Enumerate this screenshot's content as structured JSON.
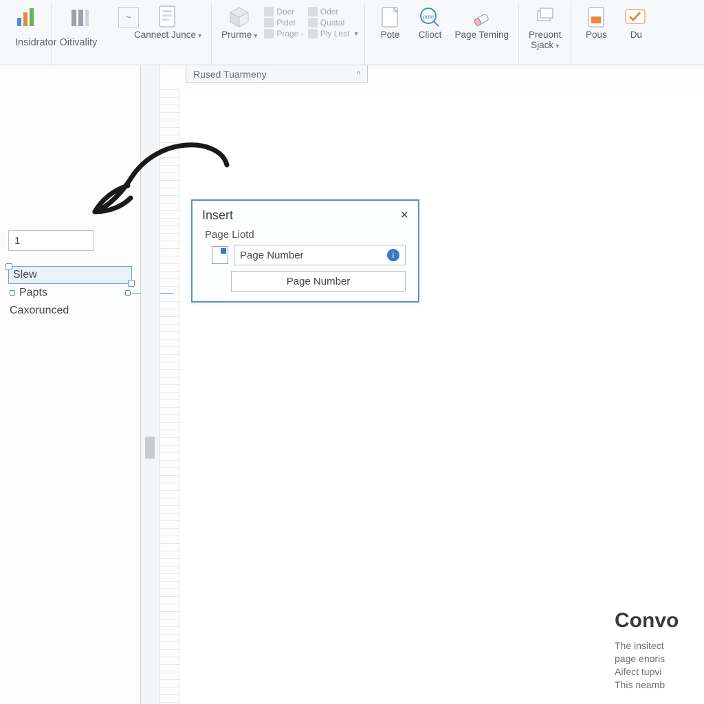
{
  "ribbon": {
    "group1": {
      "label": "Insidrator Oitivality"
    },
    "connect": {
      "label": "Cannect Junce"
    },
    "prurme": {
      "label": "Prurme",
      "sub": ""
    },
    "ministack": {
      "r1": "Doer",
      "r2": "Pidet",
      "r3": "Prage -",
      "r4": "Oder",
      "r5": "Quatal",
      "r6": "Ply Lest"
    },
    "pote": "Pote",
    "clioct": "Clioct",
    "page_teming": "Page Teming",
    "preuont": "Preuont\nSjack",
    "pous": "Pous",
    "du": "Du"
  },
  "subbar": {
    "label": "Rused Tuarmeny"
  },
  "leftpanel": {
    "search_value": "1",
    "items": [
      "Slew",
      "Papts",
      "Caxorunced"
    ]
  },
  "dialog": {
    "title": "Insert",
    "section_label": "Page Liotd",
    "field_label": "Page Number",
    "button_label": "Page Number"
  },
  "doc": {
    "heading": "Convo",
    "p1": "The insitect",
    "p2": "page enoris",
    "p3": "Aifect tupvi",
    "p4": "This neamb"
  }
}
